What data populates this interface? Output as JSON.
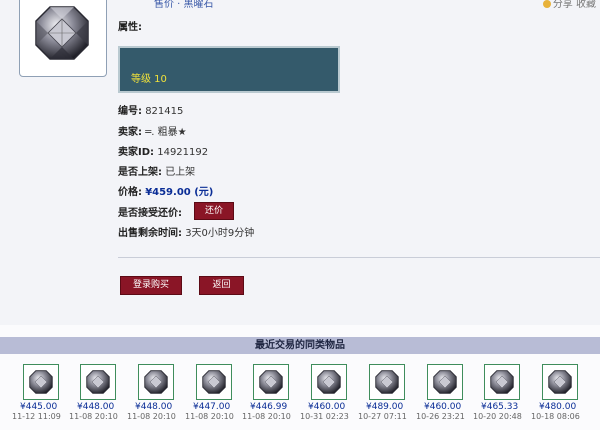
{
  "header": {
    "title_partial": "售价 · 黑曜石",
    "links_partial": "分享  收藏"
  },
  "item": {
    "attributes_label": "属性:",
    "level_text": "等级 10",
    "id_label": "编号:",
    "id_value": "821415",
    "seller_label": "卖家:",
    "seller_value": "═. 粗暴★",
    "seller_id_label": "卖家ID:",
    "seller_id_value": "14921192",
    "listed_label": "是否上架:",
    "listed_value": "已上架",
    "price_label": "价格:",
    "price_value": "¥459.00 (元)",
    "counter_label": "是否接受还价:",
    "counter_button": "还价",
    "time_left_label": "出售剩余时间:",
    "time_left_value": "3天0小时9分钟"
  },
  "actions": {
    "buy_label": "登录购买",
    "back_label": "返回"
  },
  "recent": {
    "title": "最近交易的同类物品",
    "items": [
      {
        "price": "¥445.00",
        "date": "11-12 11:09"
      },
      {
        "price": "¥448.00",
        "date": "11-08 20:10"
      },
      {
        "price": "¥448.00",
        "date": "11-08 20:10"
      },
      {
        "price": "¥447.00",
        "date": "11-08 20:10"
      },
      {
        "price": "¥446.99",
        "date": "11-08 20:10"
      },
      {
        "price": "¥460.00",
        "date": "10-31 02:23"
      },
      {
        "price": "¥489.00",
        "date": "10-27 07:11"
      },
      {
        "price": "¥460.00",
        "date": "10-26 23:21"
      },
      {
        "price": "¥465.33",
        "date": "10-20 20:48"
      },
      {
        "price": "¥480.00",
        "date": "10-18 08:06"
      }
    ]
  },
  "colors": {
    "accent_button": "#8a1526",
    "attr_box": "#345a6b",
    "level_text": "#f1e23a",
    "price": "#0a2d96",
    "section_header": "#b8bcd6"
  }
}
